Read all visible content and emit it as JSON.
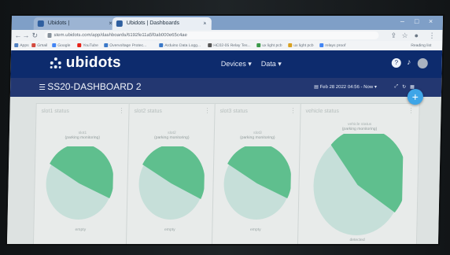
{
  "browser": {
    "tabs": [
      {
        "label": "Ubidots |"
      },
      {
        "label": "Ubidots | Dashboards"
      }
    ],
    "new_tab": "+",
    "window_controls": [
      "–",
      "□",
      "×"
    ],
    "url": "stem.ubidots.com/app/dashboards/6192fe11a5f0ab000e65c4ae",
    "bookmarks": [
      "Apps",
      "Gmail",
      "Google",
      "YouTube",
      "Overvoltage Protec...",
      "Arduino Data Logg...",
      "HC02-05 Relay Tes...",
      "ux light pcb",
      "ux light pcb",
      "relays proof",
      "Reading list"
    ]
  },
  "app": {
    "logo_text": "ubidots",
    "menu": [
      "Devices ▾",
      "Data ▾"
    ],
    "dashboard_title": "SS20-DASHBOARD 2",
    "date_range": "Feb 28 2022 04:56 - Now ▾",
    "colors": {
      "accent": "#3ea5e7",
      "header": "#0d2b6d",
      "subheader": "#233771",
      "pie_fill": "#5fbf8e",
      "pie_base": "#c6dfd9"
    }
  },
  "cards": [
    {
      "title": "slot1 status",
      "value": "slot1",
      "sub": "(parking monitoring)",
      "label": "empty"
    },
    {
      "title": "slot2 status",
      "value": "slot2",
      "sub": "(parking monitoring)",
      "label": "empty"
    },
    {
      "title": "slot3 status",
      "value": "slot3",
      "sub": "(parking monitoring)",
      "label": "empty"
    },
    {
      "title": "vehicle status",
      "value": "vehicle status",
      "sub": "(parking monitoring)",
      "label": "detected"
    }
  ]
}
